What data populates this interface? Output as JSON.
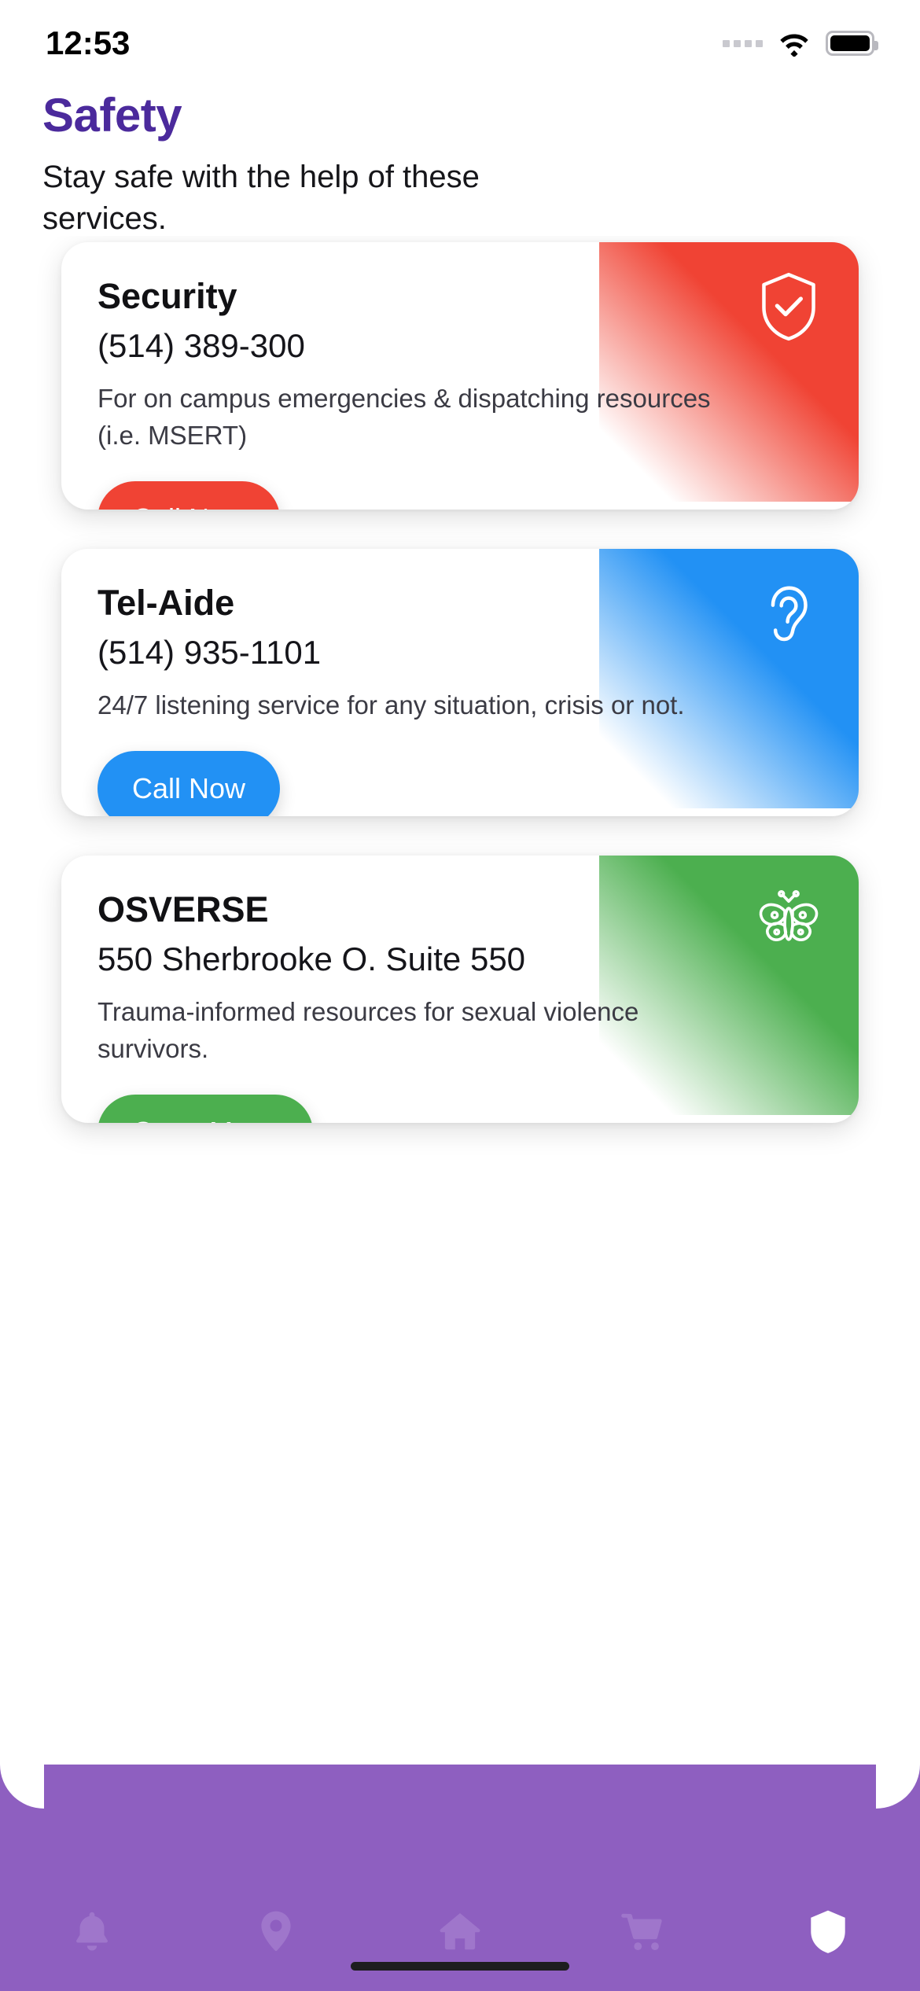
{
  "status_bar": {
    "time": "12:53",
    "signal_icon": "signal-dots-icon",
    "wifi_icon": "wifi-icon",
    "battery_icon": "battery-full-icon"
  },
  "header": {
    "title": "Safety",
    "subtitle": "Stay safe with the help of these services.",
    "title_color": "#4B2A9C"
  },
  "cards": [
    {
      "title": "Security",
      "detail": "(514) 389-300",
      "description": "For on campus emergencies & dispatching resources (i.e. MSERT)",
      "button_label": "Call Now",
      "accent_color": "#F04334",
      "icon": "shield-check-icon"
    },
    {
      "title": "Tel-Aide",
      "detail": "(514) 935-1101",
      "description": "24/7 listening service for any situation, crisis or not.",
      "button_label": "Call Now",
      "accent_color": "#2291F4",
      "icon": "ear-icon"
    },
    {
      "title": "OSVERSE",
      "detail": "550 Sherbrooke O. Suite 550",
      "description": "Trauma-informed resources for sexual violence survivors.",
      "button_label": "Open Maps",
      "accent_color": "#4CAF4F",
      "icon": "butterfly-icon"
    }
  ],
  "tabbar": {
    "background_color": "#8E5FC0",
    "items": [
      {
        "name": "notifications",
        "icon": "bell-icon",
        "active": false
      },
      {
        "name": "map",
        "icon": "location-pin-icon",
        "active": false
      },
      {
        "name": "home",
        "icon": "home-icon",
        "active": false
      },
      {
        "name": "shop",
        "icon": "shopping-cart-icon",
        "active": false
      },
      {
        "name": "safety",
        "icon": "shield-icon",
        "active": true
      }
    ]
  }
}
